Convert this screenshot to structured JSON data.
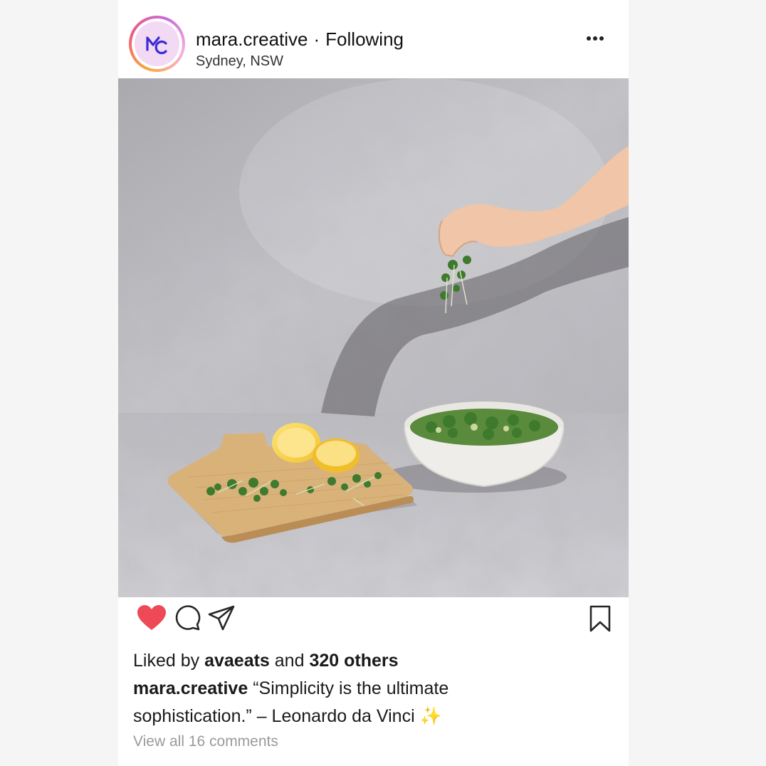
{
  "post": {
    "username": "mara.creative",
    "separator": "·",
    "follow_status": "Following",
    "location": "Sydney, NSW",
    "avatar_letters": "MC",
    "liked_by_prefix": "Liked by",
    "liked_by_user": "avaeats",
    "liked_by_joiner": "and",
    "liked_by_others": "320 others",
    "caption_user": "mara.creative",
    "caption_text": "“Simplicity is the ultimate sophistication.” – Leonardo da Vinci",
    "caption_emoji": "✨",
    "view_comments": "View all 16 comments",
    "liked": true
  },
  "icons": {
    "more": "more-horizontal-icon",
    "like": "heart-icon",
    "comment": "comment-icon",
    "share": "send-icon",
    "save": "bookmark-icon"
  },
  "colors": {
    "heart": "#ed4956",
    "muted_text": "#9a9a9a",
    "avatar_bg": "#f2d9f4",
    "avatar_logo": "#3b2bd4"
  },
  "photo": {
    "description_alt": "mara.creative post photo"
  }
}
